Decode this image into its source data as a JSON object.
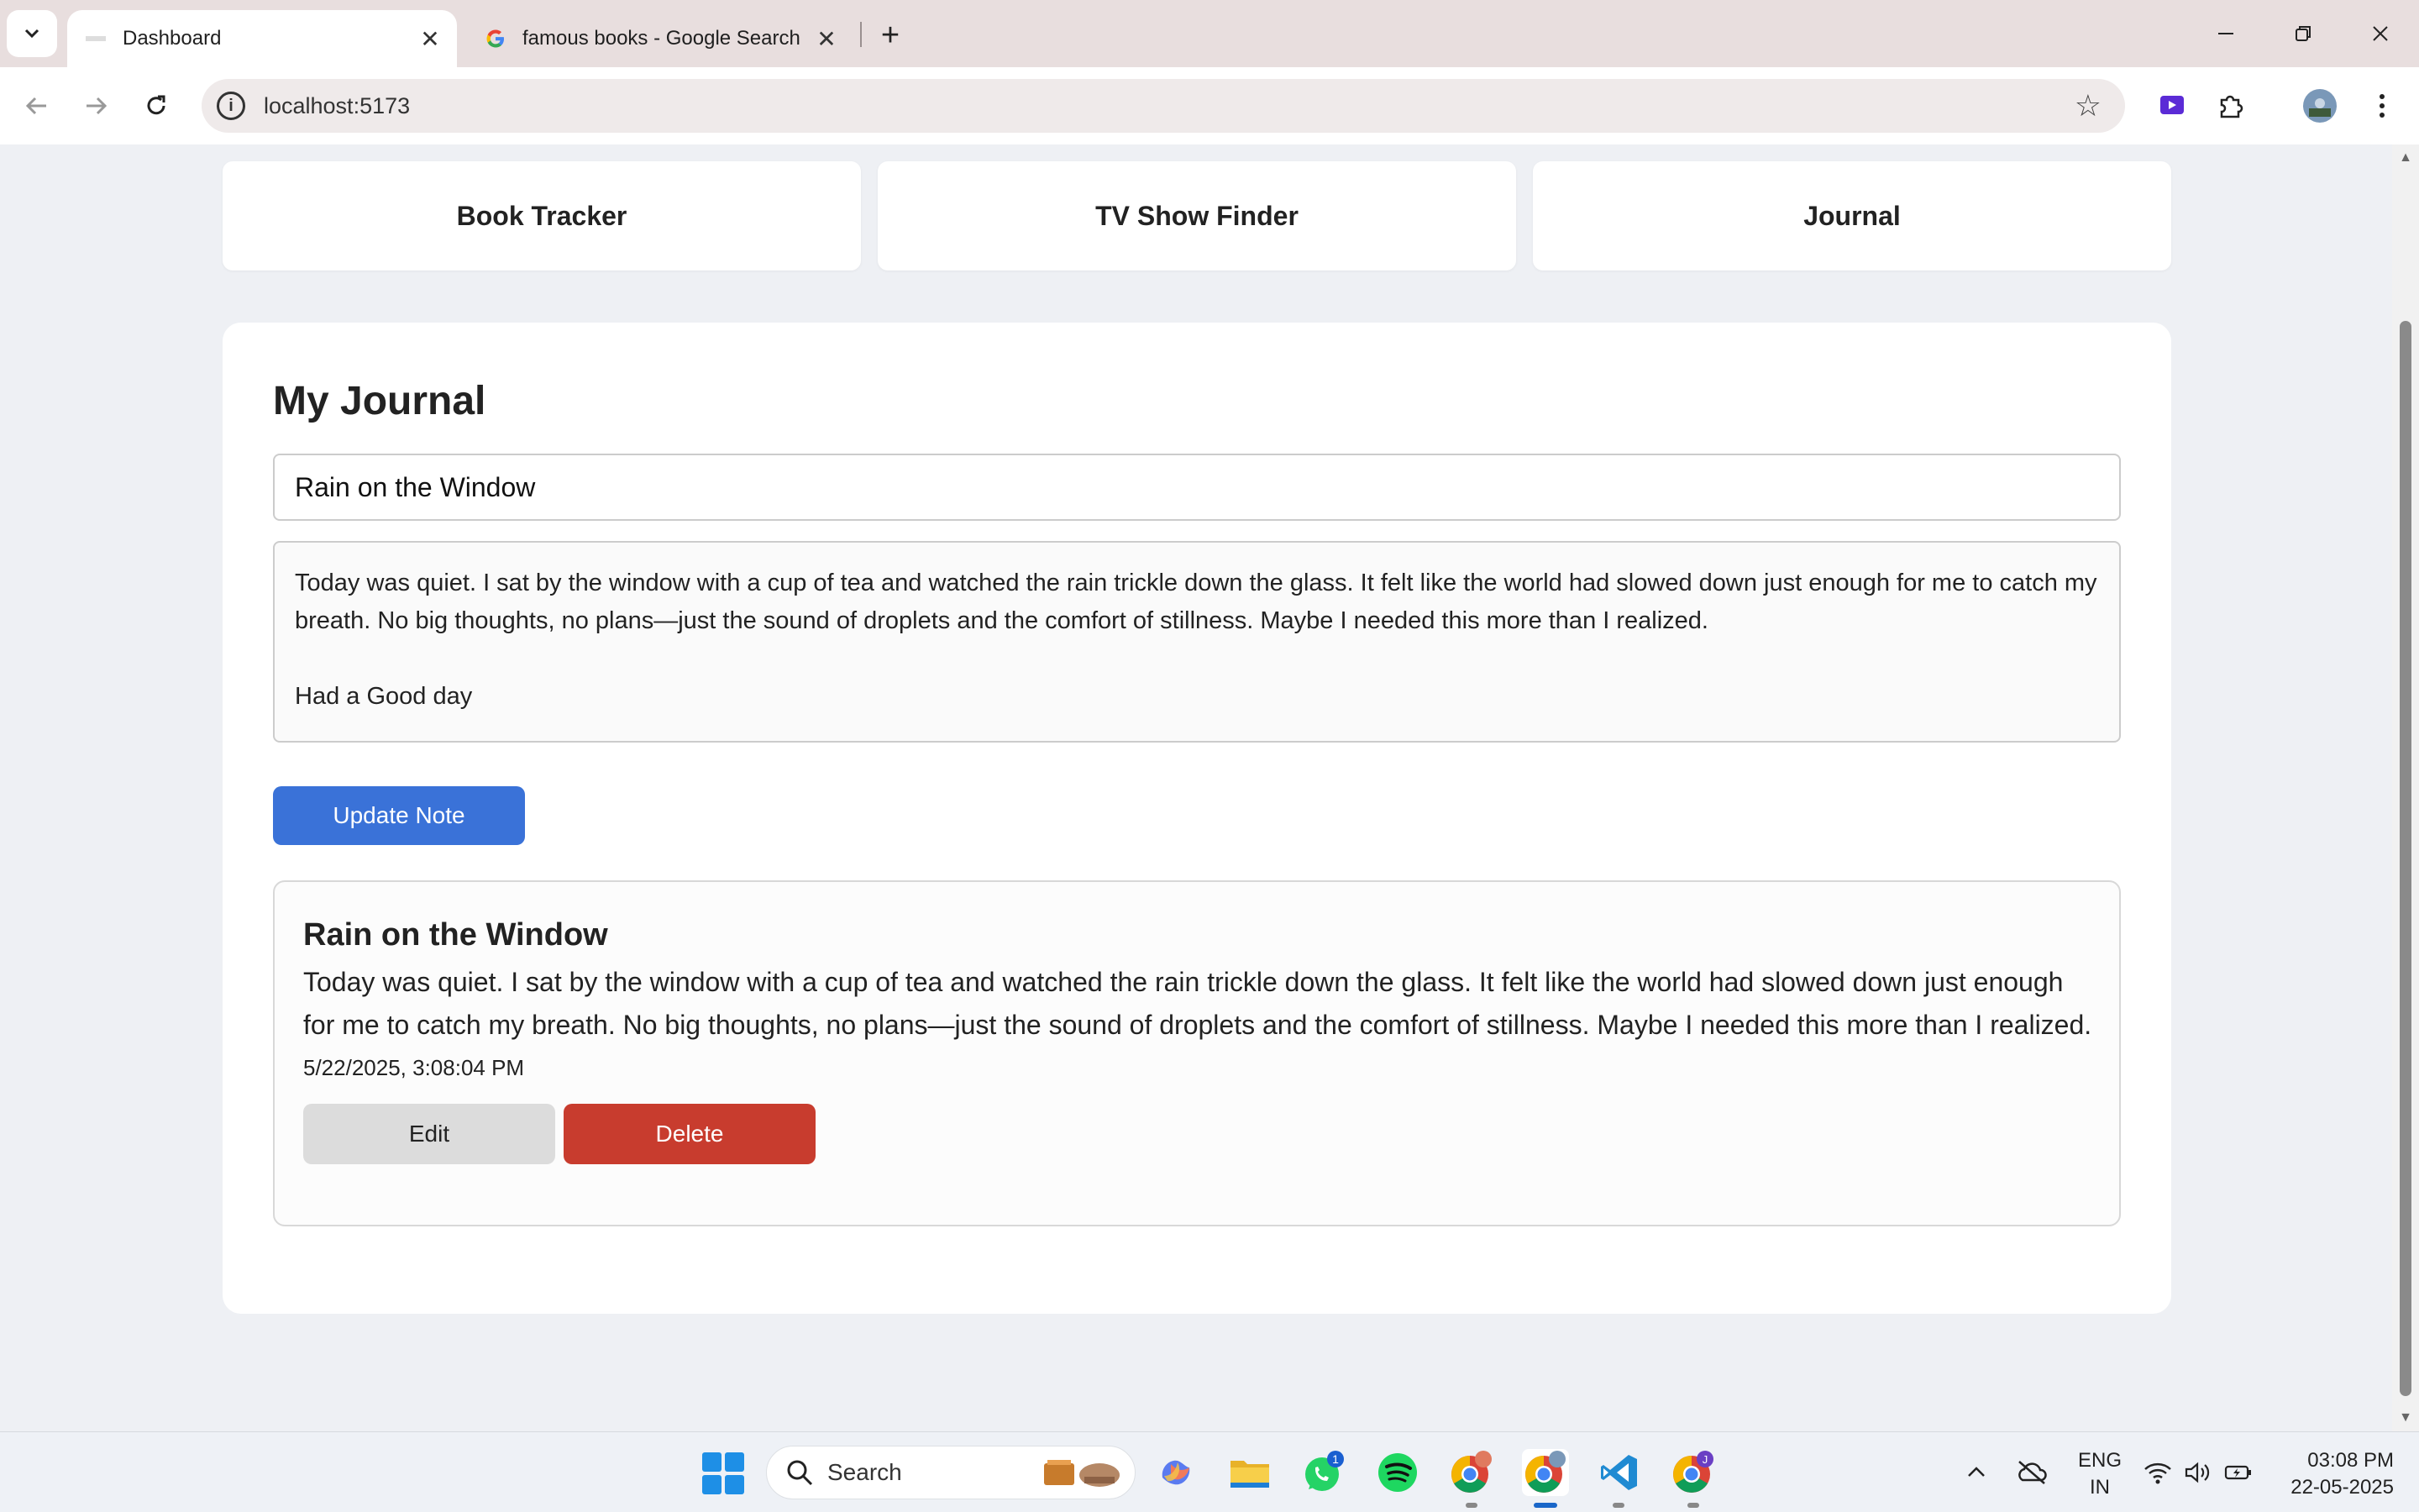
{
  "browser": {
    "tabs": [
      {
        "title": "Dashboard",
        "active": true
      },
      {
        "title": "famous books - Google Search",
        "active": false
      }
    ],
    "url": "localhost:5173"
  },
  "nav_cards": [
    {
      "label": "Book Tracker"
    },
    {
      "label": "TV Show Finder"
    },
    {
      "label": "Journal"
    }
  ],
  "journal": {
    "heading": "My Journal",
    "title_value": "Rain on the Window",
    "content_value": "Today was quiet. I sat by the window with a cup of tea and watched the rain trickle down the glass. It felt like the world had slowed down just enough for me to catch my breath. No big thoughts, no plans—just the sound of droplets and the comfort of stillness. Maybe I needed this more than I realized.\n\nHad a Good day",
    "update_label": "Update Note",
    "note": {
      "title": "Rain on the Window",
      "body": "Today was quiet. I sat by the window with a cup of tea and watched the rain trickle down the glass. It felt like the world had slowed down just enough for me to catch my breath. No big thoughts, no plans—just the sound of droplets and the comfort of stillness. Maybe I needed this more than I realized.",
      "date": "5/22/2025, 3:08:04 PM",
      "edit_label": "Edit",
      "delete_label": "Delete"
    }
  },
  "taskbar": {
    "search_label": "Search",
    "whatsapp_badge": "1",
    "chrome_profile_badge": "J",
    "lang_line1": "ENG",
    "lang_line2": "IN",
    "time": "03:08 PM",
    "date": "22-05-2025"
  },
  "colors": {
    "primary_button": "#3a72d8",
    "danger_button": "#c83c2e",
    "page_bg": "#eef0f4"
  }
}
